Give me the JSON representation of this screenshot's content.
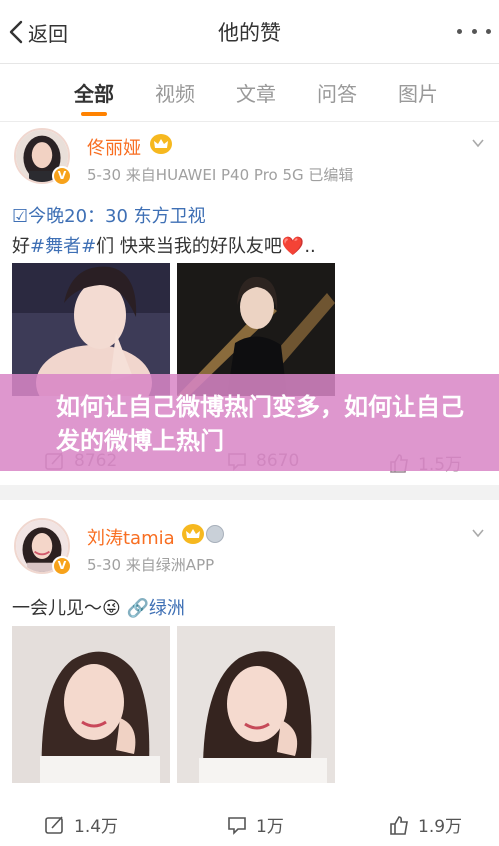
{
  "nav": {
    "back_label": "返回",
    "title": "他的赞"
  },
  "tabs": [
    "全部",
    "视频",
    "文章",
    "问答",
    "图片"
  ],
  "posts": [
    {
      "author": "佟丽娅",
      "meta": "5-30  来自HUAWEI P40 Pro 5G  已编辑",
      "headline": "☑今晚20：30 东方卫视",
      "text_prefix": "好",
      "hashtag": "#舞者#",
      "text_suffix": "们 快来当我的好队友吧",
      "heart": "❤️",
      "ellipsis": "..",
      "repost_count": "8762",
      "comment_count": "8670",
      "like_count": "1.5万"
    },
    {
      "author": "刘涛tamia",
      "meta": "5-30  来自绿洲APP",
      "text": "一会儿见～",
      "emoji": "😜",
      "link_text": "绿洲",
      "repost_count": "1.4万",
      "comment_count": "1万",
      "like_count": "1.9万"
    }
  ],
  "banner": {
    "text": "如何让自己微博热门变多，如何让自己发的微博上热门"
  },
  "colors": {
    "accent_orange": "#ff8200",
    "name_orange": "#f86e21",
    "link_blue": "#3f70b5",
    "banner_pink": "#d886c6"
  }
}
